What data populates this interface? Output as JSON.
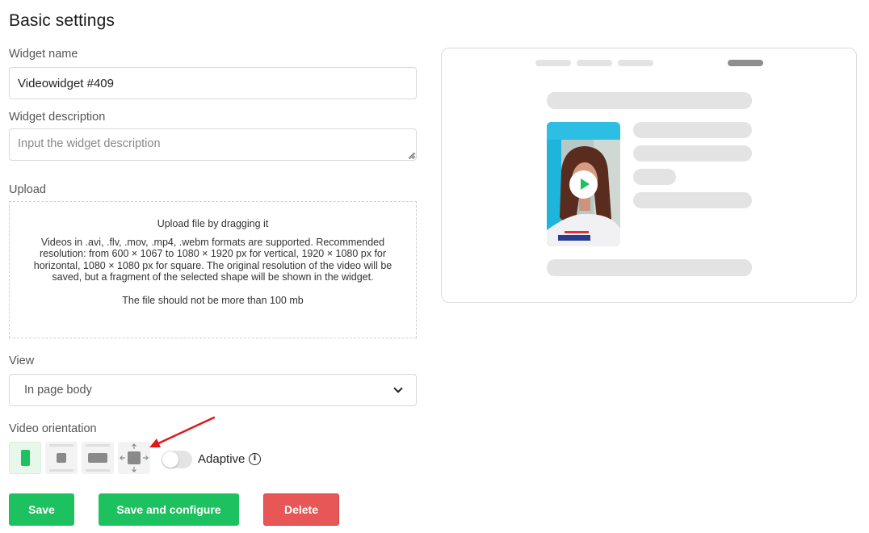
{
  "page": {
    "title": "Basic settings"
  },
  "form": {
    "widget_name_label": "Widget name",
    "widget_name_value": "Videowidget #409",
    "widget_description_label": "Widget description",
    "widget_description_placeholder": "Input the widget description",
    "upload_label": "Upload",
    "upload_title": "Upload file by dragging it",
    "upload_description": "Videos in .avi, .flv, .mov, .mp4, .webm formats are supported. Recommended resolution: from 600 × 1067 to 1080 × 1920 px for vertical, 1920 × 1080 px for horizontal, 1080 × 1080 px for square. The original resolution of the video will be saved, but a fragment of the selected shape will be shown in the widget.",
    "upload_limit": "The file should not be more than 100 mb",
    "view_label": "View",
    "view_selected": "In page body",
    "orientation_label": "Video orientation",
    "orientation_options": [
      "vertical",
      "square",
      "horizontal",
      "free-resize"
    ],
    "orientation_selected": "vertical",
    "adaptive_label": "Adaptive",
    "adaptive_on": false
  },
  "buttons": {
    "save": "Save",
    "save_configure": "Save and configure",
    "delete": "Delete"
  },
  "colors": {
    "accent_green": "#1ec15f",
    "danger_red": "#e85757",
    "annotation_arrow": "#e0191b",
    "skeleton": "#e3e3e3"
  }
}
